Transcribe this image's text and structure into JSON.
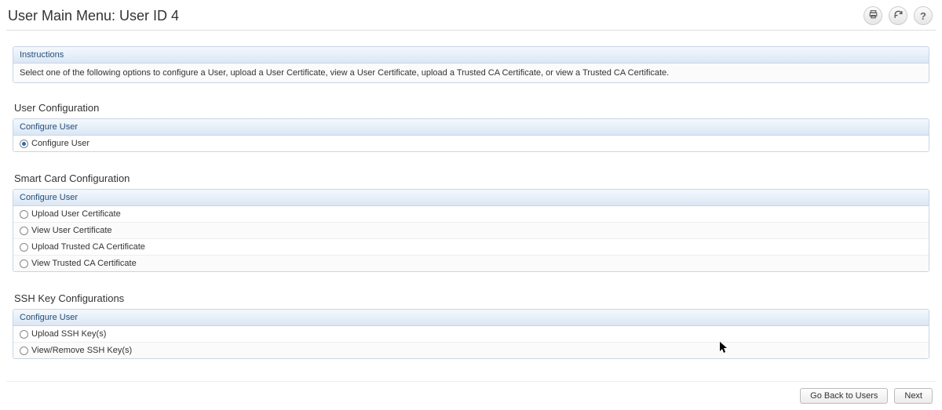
{
  "header": {
    "title": "User Main Menu: User ID 4",
    "print_tooltip": "Print",
    "refresh_tooltip": "Refresh",
    "help_tooltip": "Help"
  },
  "instructions": {
    "title": "Instructions",
    "body": "Select one of the following options to configure a User, upload a User Certificate, view a User Certificate, upload a Trusted CA Certificate, or view a Trusted CA Certificate."
  },
  "user_config": {
    "section_title": "User Configuration",
    "subheader": "Configure User",
    "options": [
      {
        "label": "Configure User",
        "selected": true
      }
    ]
  },
  "smart_card": {
    "section_title": "Smart Card Configuration",
    "subheader": "Configure User",
    "options": [
      {
        "label": "Upload User Certificate",
        "selected": false
      },
      {
        "label": "View User Certificate",
        "selected": false
      },
      {
        "label": "Upload Trusted CA Certificate",
        "selected": false
      },
      {
        "label": "View Trusted CA Certificate",
        "selected": false
      }
    ]
  },
  "ssh": {
    "section_title": "SSH Key Configurations",
    "subheader": "Configure User",
    "options": [
      {
        "label": "Upload SSH Key(s)",
        "selected": false
      },
      {
        "label": "View/Remove SSH Key(s)",
        "selected": false
      }
    ]
  },
  "footer": {
    "back": "Go Back to Users",
    "next": "Next"
  }
}
